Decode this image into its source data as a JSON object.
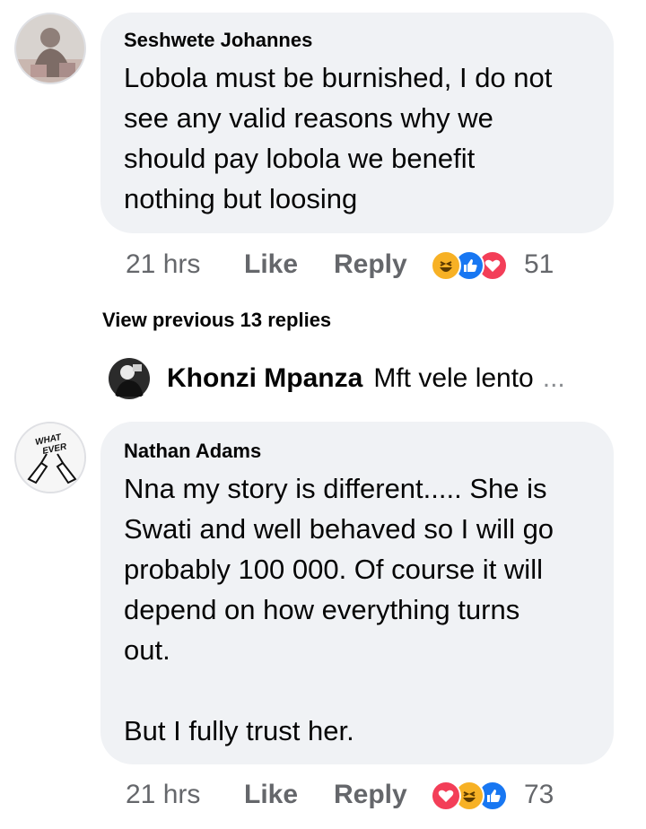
{
  "comments": [
    {
      "author": "Seshwete Johannes",
      "text": "Lobola must be burnished, I do not\nsee any valid reasons why we\nshould pay lobola we benefit\nnothing but loosing",
      "time": "21 hrs",
      "like_label": "Like",
      "reply_label": "Reply",
      "reaction_icons": [
        "haha-icon",
        "like-icon",
        "love-icon"
      ],
      "reaction_count": "51"
    },
    {
      "author": "Nathan Adams",
      "avatar_text": "WHAT EVER",
      "text": "Nna my story is different..... She is\nSwati and well behaved so I will go\nprobably 100 000. Of course it will\ndepend on how everything turns\nout.\n\nBut I fully trust her.",
      "time": "21 hrs",
      "like_label": "Like",
      "reply_label": "Reply",
      "reaction_icons": [
        "love-icon",
        "haha-icon",
        "like-icon"
      ],
      "reaction_count": "73"
    }
  ],
  "view_previous": "View previous 13 replies",
  "reply_preview": {
    "author": "Khonzi Mpanza",
    "snippet": "Mft vele lento",
    "ellipsis": "..."
  },
  "colors": {
    "bubble": "#f0f2f5",
    "like_blue": "#1877f2",
    "love_red": "#f33e58",
    "haha_yellow": "#f7b125",
    "meta_gray": "#65676b"
  }
}
